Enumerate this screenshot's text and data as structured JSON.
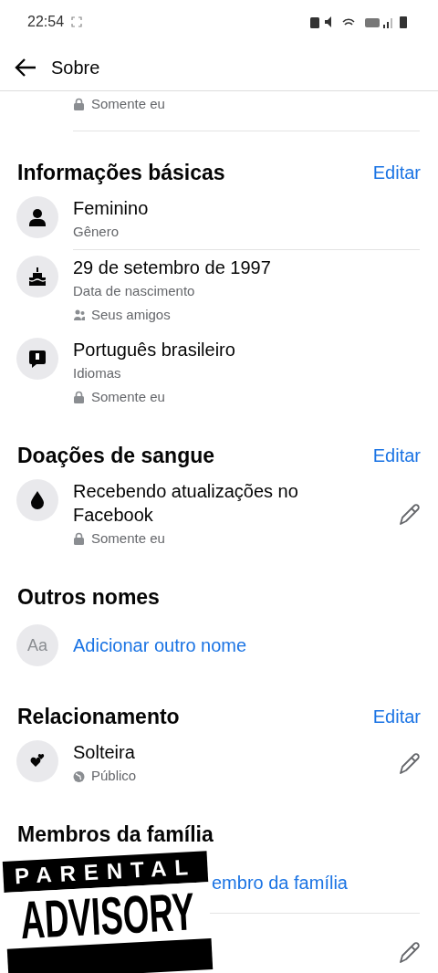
{
  "status_bar": {
    "time": "22:54"
  },
  "header": {
    "title": "Sobre"
  },
  "top_privacy": {
    "kind": "lock",
    "label": "Somente eu"
  },
  "sections": [
    {
      "title": "Informações básicas",
      "action": "Editar",
      "items": [
        {
          "kind": "gender",
          "title": "Feminino",
          "subtitle": "Gênero",
          "divider": true
        },
        {
          "kind": "birthday",
          "title": "29 de setembro de 1997",
          "subtitle": "Data de nascimento",
          "privacy": {
            "kind": "friends",
            "label": "Seus amigos"
          }
        },
        {
          "kind": "language",
          "title": "Português brasileiro",
          "subtitle": "Idiomas",
          "privacy": {
            "kind": "lock",
            "label": "Somente eu"
          }
        }
      ]
    },
    {
      "title": "Doações de sangue",
      "action": "Editar",
      "items": [
        {
          "kind": "blood",
          "title": "Recebendo atualizações no Facebook",
          "privacy": {
            "kind": "lock",
            "label": "Somente eu"
          },
          "editable": true
        }
      ]
    },
    {
      "title": "Outros nomes",
      "items": [
        {
          "kind": "add",
          "icon_text": "Aa",
          "title": "Adicionar outro nome"
        }
      ]
    },
    {
      "title": "Relacionamento",
      "action": "Editar",
      "items": [
        {
          "kind": "relationship",
          "title": "Solteira",
          "privacy": {
            "kind": "globe",
            "label": "Público"
          },
          "editable": true
        }
      ]
    },
    {
      "title": "Membros da família",
      "items": [
        {
          "kind": "covered",
          "title": "embro da família",
          "divider": true
        },
        {
          "kind": "covered_row",
          "editable": true
        }
      ]
    }
  ],
  "sticker": {
    "lines": [
      "PARENTAL",
      "ADVISORY"
    ]
  }
}
